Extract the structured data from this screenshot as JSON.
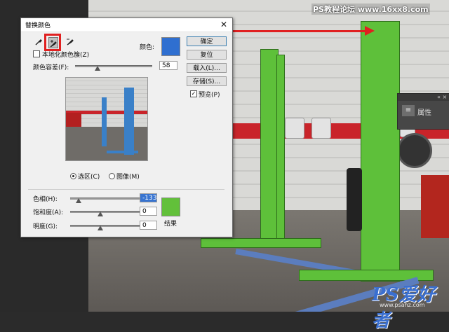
{
  "watermark": {
    "top": "PS教程论坛 www.16xx8.com",
    "logo_main": "PS爱好者",
    "logo_sub": "www.psahz.com"
  },
  "properties_panel": {
    "label": "属性",
    "menu_glyph": "≡",
    "controls": "«  ×"
  },
  "dialog": {
    "title": "替换颜色",
    "close_glyph": "✕",
    "localized_color_clusters_label": "本地化颜色簇(Z)",
    "color_label": "颜色:",
    "color_value": "#2f6fd0",
    "fuzziness_label": "颜色容差(F):",
    "fuzziness_value": "58",
    "fuzziness_level": 0.29,
    "buttons": {
      "ok": "确定",
      "reset": "复位",
      "load": "载入(L)...",
      "save": "存储(S)...",
      "preview": "预览(P)"
    },
    "preview_checked": true,
    "view_options": {
      "selection": "选区(C)",
      "image": "图像(M)",
      "selected": "selection"
    },
    "hue_label": "色相(H):",
    "hue_value": "-133",
    "saturation_label": "饱和度(A):",
    "saturation_value": "0",
    "lightness_label": "明度(G):",
    "lightness_value": "0",
    "result_label": "结果",
    "result_color": "#62c03a",
    "tools": {
      "eyedropper": "eyedropper-icon",
      "add_sample": "eyedropper-plus-icon",
      "subtract_sample": "eyedropper-minus-icon"
    }
  },
  "colors": {
    "lift_green": "#5ec03a",
    "arrow_red": "#e02020",
    "preview_blue": "#3a80c8"
  }
}
